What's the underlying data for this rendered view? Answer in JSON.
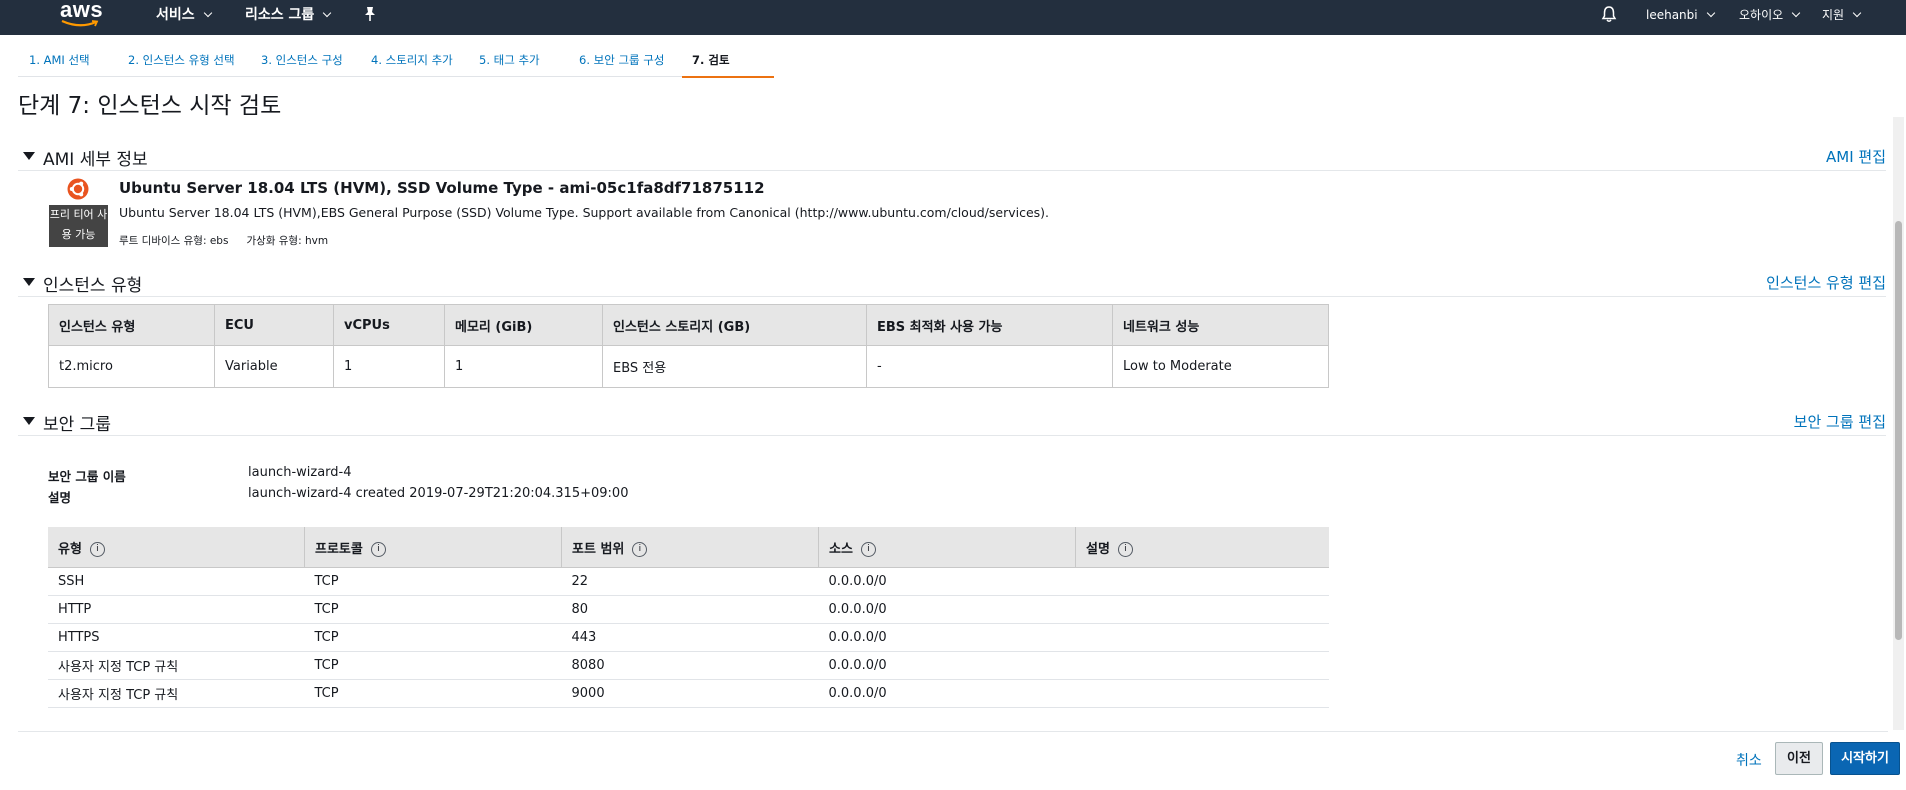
{
  "nav": {
    "logo_text": "aws",
    "services": "서비스",
    "resource_groups": "리소스 그룹",
    "user": "leehanbi",
    "region": "오하이오",
    "support": "지원"
  },
  "wizard": {
    "tabs": [
      {
        "label": "1. AMI 선택"
      },
      {
        "label": "2. 인스턴스 유형 선택"
      },
      {
        "label": "3. 인스턴스 구성"
      },
      {
        "label": "4. 스토리지 추가"
      },
      {
        "label": "5. 태그 추가"
      },
      {
        "label": "6. 보안 그룹 구성"
      },
      {
        "label": "7. 검토"
      }
    ],
    "active_index": 6
  },
  "page_title": "단계 7: 인스턴스 시작 검토",
  "ami_section": {
    "title": "AMI 세부 정보",
    "edit": "AMI 편집",
    "name": "Ubuntu Server 18.04 LTS (HVM), SSD Volume Type - ami-05c1fa8df71875112",
    "description": "Ubuntu Server 18.04 LTS (HVM),EBS General Purpose (SSD) Volume Type. Support available from Canonical (http://www.ubuntu.com/cloud/services).",
    "badge_line1": "프리 티어 사",
    "badge_line2": "용 가능",
    "root_device": "루트 디바이스 유형: ebs",
    "virtualization": "가상화 유형: hvm",
    "icon": "ubuntu-logo-icon",
    "icon_color": "#e95420"
  },
  "instance_section": {
    "title": "인스턴스 유형",
    "edit": "인스턴스 유형 편집",
    "headers": [
      "인스턴스 유형",
      "ECU",
      "vCPUs",
      "메모리 (GiB)",
      "인스턴스 스토리지 (GB)",
      "EBS 최적화 사용 가능",
      "네트워크 성능"
    ],
    "row": [
      "t2.micro",
      "Variable",
      "1",
      "1",
      "EBS 전용",
      "-",
      "Low to Moderate"
    ]
  },
  "security_section": {
    "title": "보안 그룹",
    "edit": "보안 그룹 편집",
    "name_label": "보안 그룹 이름",
    "name_value": "launch-wizard-4",
    "desc_label": "설명",
    "desc_value": "launch-wizard-4 created 2019-07-29T21:20:04.315+09:00",
    "headers": [
      "유형",
      "프로토콜",
      "포트 범위",
      "소스",
      "설명"
    ],
    "info_glyph": "i",
    "rules": [
      [
        "SSH",
        "TCP",
        "22",
        "0.0.0.0/0",
        ""
      ],
      [
        "HTTP",
        "TCP",
        "80",
        "0.0.0.0/0",
        ""
      ],
      [
        "HTTPS",
        "TCP",
        "443",
        "0.0.0.0/0",
        ""
      ],
      [
        "사용자 지정 TCP 규칙",
        "TCP",
        "8080",
        "0.0.0.0/0",
        ""
      ],
      [
        "사용자 지정 TCP 규칙",
        "TCP",
        "9000",
        "0.0.0.0/0",
        ""
      ]
    ]
  },
  "footer": {
    "cancel": "취소",
    "previous": "이전",
    "launch": "시작하기"
  },
  "colors": {
    "nav_bg": "#232f3e",
    "link": "#0073bb",
    "active_tab": "#ec7211",
    "primary_button": "#0a66b3"
  }
}
